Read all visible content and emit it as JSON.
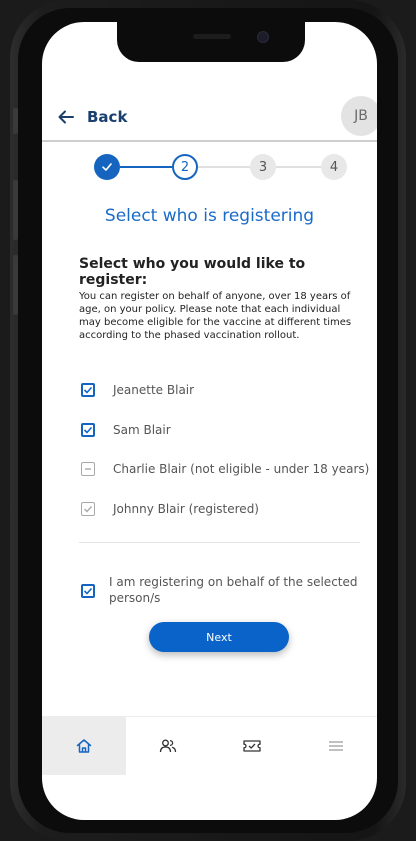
{
  "header": {
    "back_label": "Back",
    "avatar_initials": "JB"
  },
  "stepper": {
    "steps": [
      {
        "label": "",
        "state": "done"
      },
      {
        "label": "2",
        "state": "current"
      },
      {
        "label": "3",
        "state": "upcoming"
      },
      {
        "label": "4",
        "state": "upcoming"
      }
    ]
  },
  "page": {
    "title": "Select who is registering",
    "section_title": "Select who you would like to register:",
    "description": "You can register on behalf of anyone, over 18 years of age, on your policy. Please note that each individual may become eligible for the vaccine at different times according to the phased vaccination rollout."
  },
  "people": [
    {
      "name": "Jeanette Blair",
      "state": "checked"
    },
    {
      "name": "Sam Blair",
      "state": "checked"
    },
    {
      "name": "Charlie Blair (not eligible - under 18 years)",
      "state": "ineligible"
    },
    {
      "name": "Johnny Blair (registered)",
      "state": "registered"
    }
  ],
  "consent": {
    "label": "I am registering on behalf of the selected person/s",
    "checked": true
  },
  "actions": {
    "next_label": "Next"
  },
  "tabbar": {
    "tabs": [
      {
        "icon": "home-icon",
        "active": true
      },
      {
        "icon": "people-icon",
        "active": false
      },
      {
        "icon": "ticket-icon",
        "active": false
      },
      {
        "icon": "menu-icon",
        "active": false
      }
    ]
  },
  "colors": {
    "primary": "#1565c0",
    "title": "#1a6bc9",
    "header_text": "#1a3f6e",
    "button": "#0a63c9"
  }
}
